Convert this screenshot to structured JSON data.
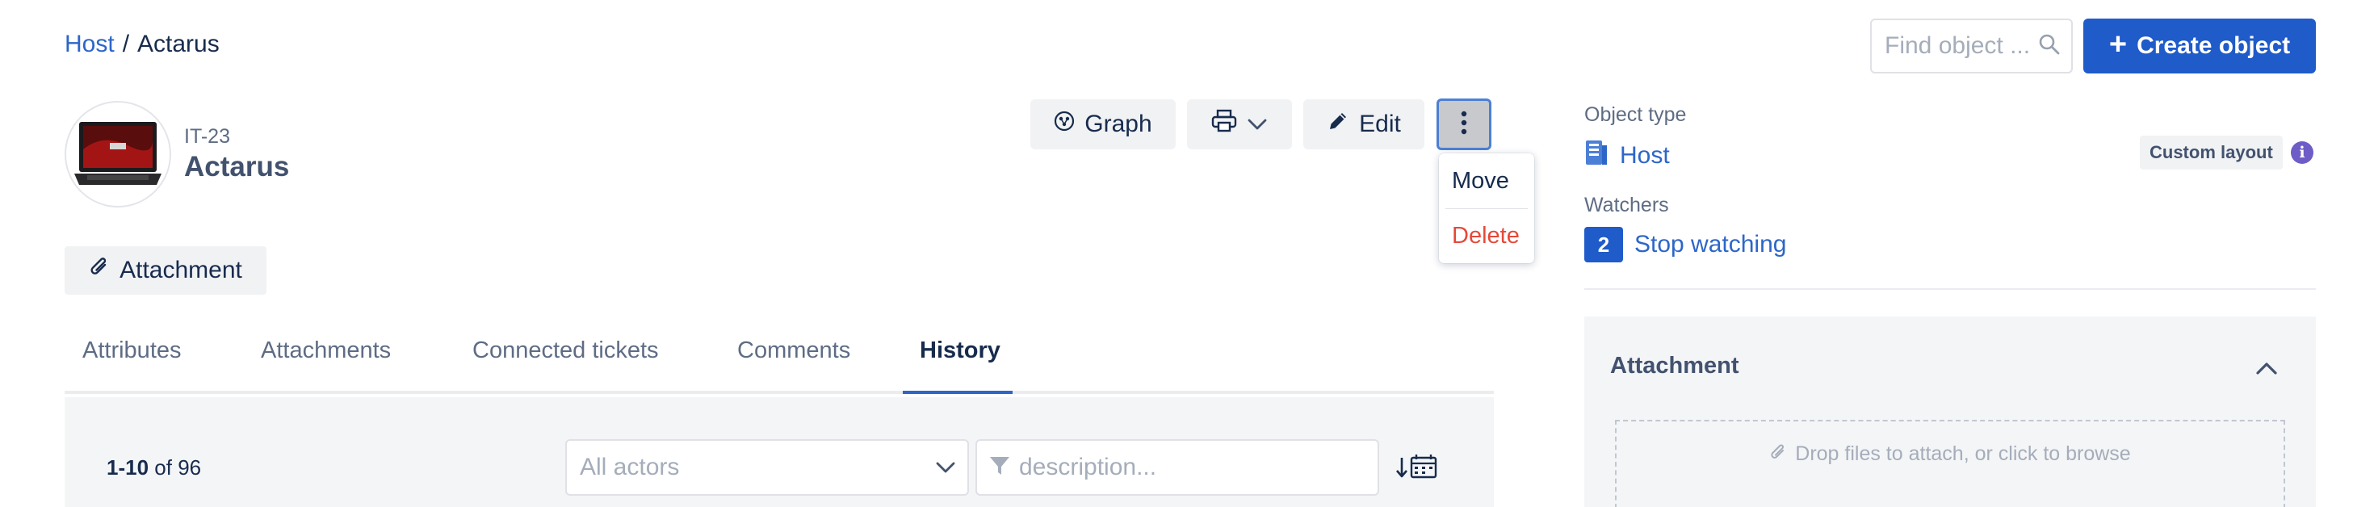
{
  "breadcrumb": {
    "parent": "Host",
    "separator": "/",
    "current": "Actarus"
  },
  "search": {
    "placeholder": "Find object ..."
  },
  "create_button": {
    "label": "Create object"
  },
  "object": {
    "key": "IT-23",
    "name": "Actarus"
  },
  "toolbar": {
    "graph_label": "Graph",
    "edit_label": "Edit"
  },
  "more_menu": {
    "items": [
      "Move",
      "Delete"
    ]
  },
  "attachment_button": {
    "label": "Attachment"
  },
  "tabs": [
    "Attributes",
    "Attachments",
    "Connected tickets",
    "Comments",
    "History"
  ],
  "active_tab": "History",
  "history": {
    "range": "1-10",
    "of_text": "of",
    "total": "96",
    "actors_placeholder": "All actors",
    "description_placeholder": "description..."
  },
  "sidebar": {
    "object_type_label": "Object type",
    "object_type_value": "Host",
    "custom_layout_label": "Custom layout",
    "info_glyph": "i",
    "watchers_label": "Watchers",
    "watchers_count": "2",
    "watch_action": "Stop watching",
    "attachment_title": "Attachment",
    "dropzone_text": "Drop files to attach, or click to browse"
  },
  "colors": {
    "primary": "#1f5bc9",
    "link": "#2d66c8",
    "danger": "#e5493a",
    "info": "#6e5dc6"
  }
}
